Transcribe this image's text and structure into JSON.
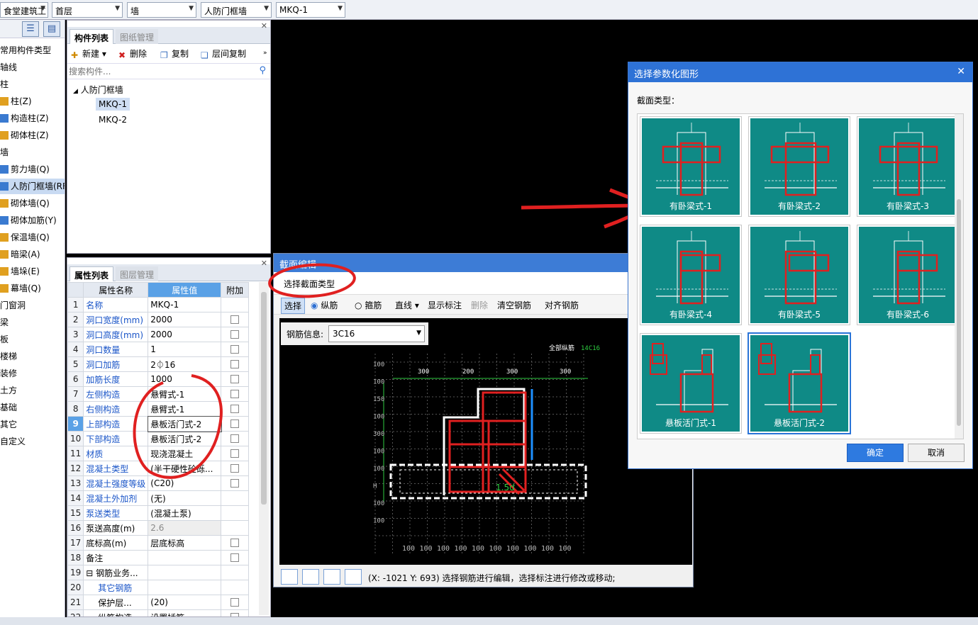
{
  "topbar": {
    "combos": [
      "食堂建筑工",
      "首层",
      "墙",
      "人防门框墙",
      "MKQ-1"
    ]
  },
  "leftnav": {
    "items": [
      {
        "label": "常用构件类型"
      },
      {
        "label": "轴线"
      },
      {
        "label": "柱"
      },
      {
        "label": "柱(Z)"
      },
      {
        "label": "构造柱(Z)"
      },
      {
        "label": "砌体柱(Z)"
      },
      {
        "label": "墙"
      },
      {
        "label": "剪力墙(Q)"
      },
      {
        "label": "人防门框墙(RF"
      },
      {
        "label": "砌体墙(Q)"
      },
      {
        "label": "砌体加筋(Y)"
      },
      {
        "label": "保温墙(Q)"
      },
      {
        "label": "暗梁(A)"
      },
      {
        "label": "墙垛(E)"
      },
      {
        "label": "幕墙(Q)"
      },
      {
        "label": "门窗洞"
      },
      {
        "label": "梁"
      },
      {
        "label": "板"
      },
      {
        "label": "楼梯"
      },
      {
        "label": "装修"
      },
      {
        "label": "土方"
      },
      {
        "label": "基础"
      },
      {
        "label": "其它"
      },
      {
        "label": "自定义"
      }
    ]
  },
  "component_panel": {
    "tab_active": "构件列表",
    "tab_inactive": "图纸管理",
    "toolbar": {
      "new": "新建",
      "delete": "删除",
      "copy": "复制",
      "floor_copy": "层间复制"
    },
    "search_placeholder": "搜索构件...",
    "tree_root": "人防门框墙",
    "tree_items": [
      "MKQ-1",
      "MKQ-2"
    ]
  },
  "property_panel": {
    "tab_active": "属性列表",
    "tab_inactive": "图层管理",
    "headers": {
      "name": "属性名称",
      "value": "属性值",
      "extra": "附加"
    },
    "rows": [
      {
        "num": "1",
        "name": "名称",
        "value": "MKQ-1",
        "blue": true,
        "check": false
      },
      {
        "num": "2",
        "name": "洞口宽度(mm)",
        "value": "2000",
        "blue": true,
        "check": true
      },
      {
        "num": "3",
        "name": "洞口高度(mm)",
        "value": "2000",
        "blue": true,
        "check": true
      },
      {
        "num": "4",
        "name": "洞口数量",
        "value": "1",
        "blue": true,
        "check": true
      },
      {
        "num": "5",
        "name": "洞口加筋",
        "value": "2⏀16",
        "blue": true,
        "check": true
      },
      {
        "num": "6",
        "name": "加筋长度",
        "value": "1000",
        "blue": true,
        "check": true
      },
      {
        "num": "7",
        "name": "左侧构造",
        "value": "悬臂式-1",
        "blue": true,
        "check": true
      },
      {
        "num": "8",
        "name": "右侧构造",
        "value": "悬臂式-1",
        "blue": true,
        "check": true
      },
      {
        "num": "9",
        "name": "上部构造",
        "value": "悬板活门式-2",
        "blue": true,
        "check": true
      },
      {
        "num": "10",
        "name": "下部构造",
        "value": "悬板活门式-2",
        "blue": true,
        "check": true
      },
      {
        "num": "11",
        "name": "材质",
        "value": "现浇混凝土",
        "blue": true,
        "check": true
      },
      {
        "num": "12",
        "name": "混凝土类型",
        "value": "(半干硬性砼砾...",
        "blue": true,
        "check": true
      },
      {
        "num": "13",
        "name": "混凝土强度等级",
        "value": "(C20)",
        "blue": true,
        "check": true
      },
      {
        "num": "14",
        "name": "混凝土外加剂",
        "value": "(无)",
        "blue": true,
        "check": false
      },
      {
        "num": "15",
        "name": "泵送类型",
        "value": "(混凝土泵)",
        "blue": true,
        "check": false
      },
      {
        "num": "16",
        "name": "泵送高度(m)",
        "value": "2.6",
        "blue": false,
        "check": false,
        "gray": true
      },
      {
        "num": "17",
        "name": "底标高(m)",
        "value": "层底标高",
        "blue": false,
        "check": true
      },
      {
        "num": "18",
        "name": "备注",
        "value": "",
        "blue": false,
        "check": true
      },
      {
        "num": "19",
        "name": "⊟ 钢筋业务...",
        "value": "",
        "blue": false,
        "check": false
      },
      {
        "num": "20",
        "name": "其它钢筋",
        "value": "",
        "blue": true,
        "check": false
      },
      {
        "num": "21",
        "name": "保护层...",
        "value": "(20)",
        "blue": false,
        "check": true
      },
      {
        "num": "22",
        "name": "纵筋构造",
        "value": "设置插筋",
        "blue": false,
        "check": true
      }
    ]
  },
  "section_editor": {
    "title": "截面编辑",
    "select_type_button": "选择截面类型",
    "toolbar": {
      "select": "选择",
      "longitudinal": "纵筋",
      "stirrup": "箍筋",
      "line": "直线",
      "show_dim": "显示标注",
      "delete": "删除",
      "clear": "清空钢筋",
      "align": "对齐钢筋"
    },
    "rebar_info_label": "钢筋信息:",
    "rebar_info_value": "3C16",
    "status": "(X: -1021 Y: 693)  选择钢筋进行编辑，选择标注进行修改或移动;",
    "canvas_labels": {
      "all_long": "全部纵筋",
      "all_long_val": "14C16",
      "dims_top": [
        "300",
        "200",
        "300",
        "300"
      ],
      "dims_left": [
        "100",
        "100",
        "150",
        "100",
        "300",
        "100",
        "100",
        "H",
        "100",
        "100"
      ],
      "dims_bottom": [
        "100",
        "100",
        "100",
        "100",
        "100",
        "100",
        "100",
        "100",
        "100",
        "100"
      ],
      "anchor": "1.5d"
    }
  },
  "dialog": {
    "title": "选择参数化图形",
    "section_label": "截面类型：",
    "tiles": [
      "有卧梁式-1",
      "有卧梁式-2",
      "有卧梁式-3",
      "有卧梁式-4",
      "有卧梁式-5",
      "有卧梁式-6",
      "悬板活门式-1",
      "悬板活门式-2"
    ],
    "ok": "确定",
    "cancel": "取消"
  },
  "colors": {
    "teal": "#0f8a86",
    "accent_blue": "#2e72d6",
    "rebar_red": "#e02020"
  }
}
